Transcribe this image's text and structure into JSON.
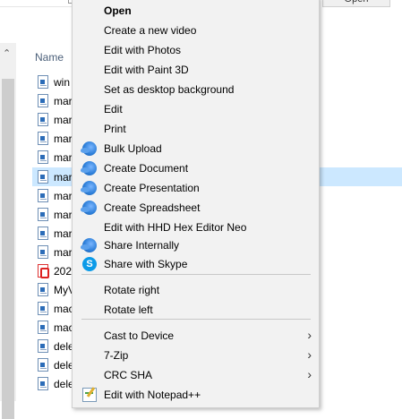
{
  "top_bar": {
    "open_label": "Open"
  },
  "file_list": {
    "column_name": "Name",
    "rows": [
      {
        "name": "win",
        "icon": "document-icon",
        "selected": false
      },
      {
        "name": "mar",
        "icon": "document-icon",
        "selected": false
      },
      {
        "name": "mar",
        "icon": "document-icon",
        "selected": false
      },
      {
        "name": "mar",
        "icon": "document-icon",
        "selected": false
      },
      {
        "name": "mar",
        "icon": "document-icon",
        "selected": false
      },
      {
        "name": "mar",
        "icon": "document-icon",
        "selected": true
      },
      {
        "name": "mar",
        "icon": "document-icon",
        "selected": false
      },
      {
        "name": "mar",
        "icon": "document-icon",
        "selected": false
      },
      {
        "name": "mar",
        "icon": "document-icon",
        "selected": false
      },
      {
        "name": "mar",
        "icon": "document-icon",
        "selected": false
      },
      {
        "name": "202",
        "icon": "pdf-icon",
        "selected": false
      },
      {
        "name": "MyV",
        "icon": "document-icon",
        "selected": false
      },
      {
        "name": "mac",
        "icon": "document-icon",
        "selected": false
      },
      {
        "name": "mac",
        "icon": "document-icon",
        "selected": false
      },
      {
        "name": "dele",
        "icon": "document-icon",
        "selected": false
      },
      {
        "name": "dele",
        "icon": "document-icon",
        "selected": false
      },
      {
        "name": "dele",
        "icon": "document-icon",
        "selected": false
      }
    ]
  },
  "context_menu": {
    "items": [
      {
        "label": "Open",
        "bold": true
      },
      {
        "label": "Create a new video"
      },
      {
        "label": "Edit with Photos"
      },
      {
        "label": "Edit with Paint 3D"
      },
      {
        "label": "Set as desktop background"
      },
      {
        "label": "Edit"
      },
      {
        "label": "Print"
      },
      {
        "label": "Bulk Upload",
        "icon": "cloud-upload-icon"
      },
      {
        "label": "Create Document",
        "icon": "cloud-upload-icon"
      },
      {
        "label": "Create Presentation",
        "icon": "cloud-upload-icon"
      },
      {
        "label": "Create Spreadsheet",
        "icon": "cloud-upload-icon"
      },
      {
        "label": "Edit with HHD Hex Editor Neo"
      },
      {
        "label": "Share Internally",
        "icon": "cloud-upload-icon"
      },
      {
        "label": "Share with Skype",
        "icon": "skype-icon"
      },
      {
        "label": "Rotate right"
      },
      {
        "label": "Rotate left"
      },
      {
        "label": "Cast to Device",
        "submenu": true
      },
      {
        "label": "7-Zip",
        "submenu": true
      },
      {
        "label": "CRC SHA",
        "submenu": true
      },
      {
        "label": "Edit with Notepad++",
        "icon": "notepad-icon"
      }
    ],
    "skype_glyph": "S",
    "chevron_glyph": "›"
  },
  "colors": {
    "menu_background": "#f2f2f2",
    "selection": "#cce8ff",
    "header_text": "#4c607a"
  }
}
